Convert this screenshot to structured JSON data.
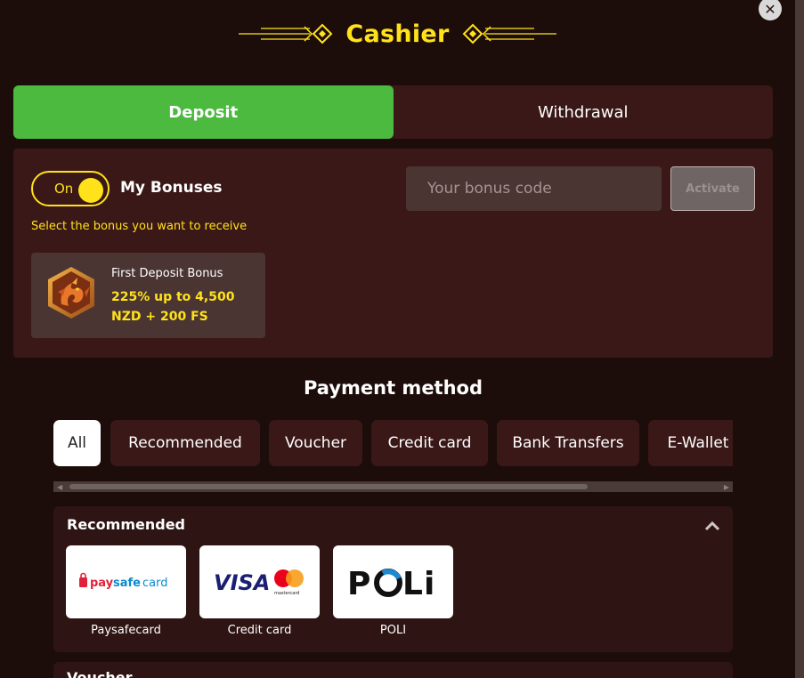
{
  "header": {
    "title": "Cashier"
  },
  "tabs": [
    {
      "label": "Deposit",
      "active": true
    },
    {
      "label": "Withdrawal",
      "active": false
    }
  ],
  "bonus": {
    "toggle_label": "On",
    "toggle_on": true,
    "my_bonuses_label": "My Bonuses",
    "hint": "Select the bonus you want to receive",
    "code_placeholder": "Your bonus code",
    "activate_label": "Activate",
    "card": {
      "title": "First Deposit Bonus",
      "offer": "225% up to 4,500 NZD + 200 FS",
      "icon": "dragon-badge-icon"
    }
  },
  "payment": {
    "title": "Payment method",
    "filters": [
      "All",
      "Recommended",
      "Voucher",
      "Credit card",
      "Bank Transfers",
      "E-Wallet"
    ],
    "active_filter": "All",
    "sections": [
      {
        "title": "Recommended",
        "expanded": true,
        "methods": [
          {
            "name": "Paysafecard",
            "logo_text": "paysafecard"
          },
          {
            "name": "Credit card",
            "logo_text": "VISA"
          },
          {
            "name": "POLI",
            "logo_text": "POLi"
          }
        ]
      },
      {
        "title": "Voucher",
        "expanded": false
      }
    ]
  },
  "colors": {
    "background": "#1c0d0a",
    "panel": "#3a1817",
    "accent_green": "#4cb93f",
    "accent_yellow": "#ffe21a"
  }
}
